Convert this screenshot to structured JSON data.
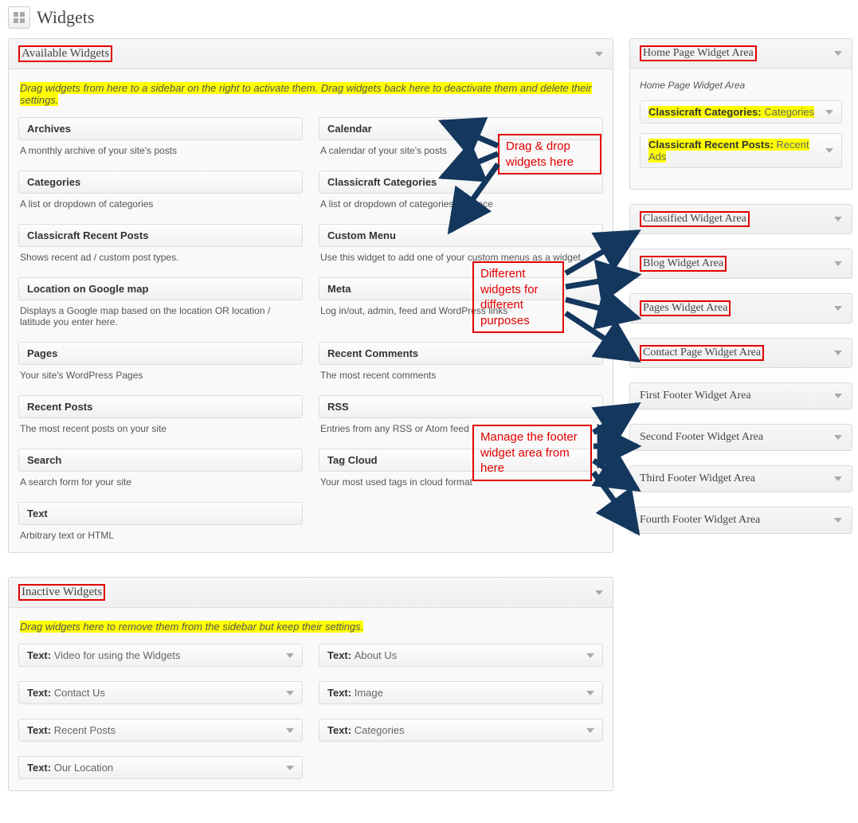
{
  "page": {
    "title": "Widgets"
  },
  "available": {
    "heading": "Available Widgets",
    "help": "Drag widgets from here to a sidebar on the right to activate them. Drag widgets back here to deactivate them and delete their settings.",
    "items": [
      {
        "title": "Archives",
        "desc": "A monthly archive of your site's posts"
      },
      {
        "title": "Calendar",
        "desc": "A calendar of your site's posts"
      },
      {
        "title": "Categories",
        "desc": "A list or dropdown of categories"
      },
      {
        "title": "Classicraft Categories",
        "desc": "A list or dropdown of categories for place"
      },
      {
        "title": "Classicraft Recent Posts",
        "desc": "Shows recent ad / custom post types."
      },
      {
        "title": "Custom Menu",
        "desc": "Use this widget to add one of your custom menus as a widget."
      },
      {
        "title": "Location on Google map",
        "desc": "Displays a Google map based on the location OR location / latitude you enter here."
      },
      {
        "title": "Meta",
        "desc": "Log in/out, admin, feed and WordPress links"
      },
      {
        "title": "Pages",
        "desc": "Your site's WordPress Pages"
      },
      {
        "title": "Recent Comments",
        "desc": "The most recent comments"
      },
      {
        "title": "Recent Posts",
        "desc": "The most recent posts on your site"
      },
      {
        "title": "RSS",
        "desc": "Entries from any RSS or Atom feed"
      },
      {
        "title": "Search",
        "desc": "A search form for your site"
      },
      {
        "title": "Tag Cloud",
        "desc": "Your most used tags in cloud format"
      },
      {
        "title": "Text",
        "desc": "Arbitrary text or HTML"
      }
    ]
  },
  "inactive": {
    "heading": "Inactive Widgets",
    "help": "Drag widgets here to remove them from the sidebar but keep their settings.",
    "items": [
      {
        "type": "Text:",
        "label": "Video for using the Widgets"
      },
      {
        "type": "Text:",
        "label": "About Us"
      },
      {
        "type": "Text:",
        "label": "Contact Us"
      },
      {
        "type": "Text:",
        "label": "Image"
      },
      {
        "type": "Text:",
        "label": "Recent Posts"
      },
      {
        "type": "Text:",
        "label": "Categories"
      },
      {
        "type": "Text:",
        "label": "Our Location"
      }
    ]
  },
  "areas": {
    "home": {
      "heading": "Home Page Widget Area",
      "subtitle": "Home Page Widget Area",
      "widgets": [
        {
          "name": "Classicraft Categories:",
          "instance": "Categories"
        },
        {
          "name": "Classicraft Recent Posts:",
          "instance": "Recent Ads"
        }
      ]
    },
    "others": [
      {
        "heading": "Classified Widget Area"
      },
      {
        "heading": "Blog Widget Area"
      },
      {
        "heading": "Pages Widget Area"
      },
      {
        "heading": "Contact Page Widget Area"
      },
      {
        "heading": "First Footer Widget Area"
      },
      {
        "heading": "Second Footer Widget Area"
      },
      {
        "heading": "Third Footer Widget Area"
      },
      {
        "heading": "Fourth Footer Widget Area"
      }
    ]
  },
  "annotations": {
    "a1": "Drag & drop widgets here",
    "a2": "Different widgets for different purposes",
    "a3": "Manage the footer widget area from here"
  }
}
